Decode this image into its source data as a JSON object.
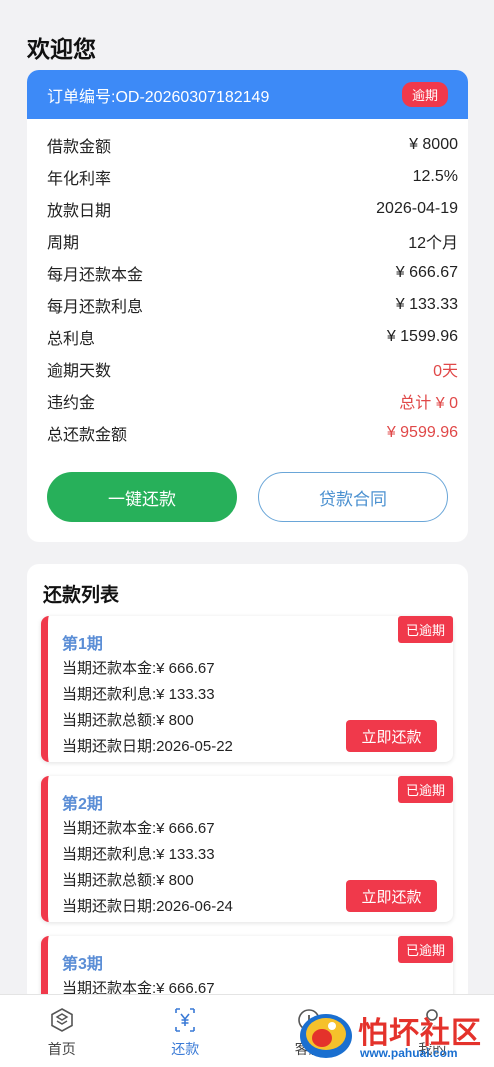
{
  "greeting": "欢迎您",
  "order": {
    "number_label": "订单编号:OD-20260307182149",
    "status_tag": "逾期",
    "rows": [
      {
        "label": "借款金额",
        "value": "¥ 8000"
      },
      {
        "label": "年化利率",
        "value": "12.5%"
      },
      {
        "label": "放款日期",
        "value": "2026-04-19"
      },
      {
        "label": "周期",
        "value": "12个月"
      },
      {
        "label": "每月还款本金",
        "value": "¥ 666.67"
      },
      {
        "label": "每月还款利息",
        "value": "¥ 133.33"
      },
      {
        "label": "总利息",
        "value": "¥ 1599.96"
      },
      {
        "label": "逾期天数",
        "value": "0天"
      },
      {
        "label": "违约金",
        "value": "总计 ¥ 0"
      },
      {
        "label": "总还款金额",
        "value": "¥ 9599.96"
      }
    ],
    "repay_button": "一键还款",
    "contract_button": "贷款合同"
  },
  "repay_list": {
    "title": "还款列表",
    "periods": [
      {
        "title": "第1期",
        "badge": "已逾期",
        "principal": "当期还款本金:¥ 666.67",
        "interest": "当期还款利息:¥ 133.33",
        "total": "当期还款总额:¥ 800",
        "date": "当期还款日期:2026-05-22",
        "button": "立即还款"
      },
      {
        "title": "第2期",
        "badge": "已逾期",
        "principal": "当期还款本金:¥ 666.67",
        "interest": "当期还款利息:¥ 133.33",
        "total": "当期还款总额:¥ 800",
        "date": "当期还款日期:2026-06-24",
        "button": "立即还款"
      },
      {
        "title": "第3期",
        "badge": "已逾期",
        "principal": "当期还款本金:¥ 666.67"
      }
    ]
  },
  "tabbar": {
    "home": "首页",
    "repay": "还款",
    "service": "客服",
    "mine": "我的"
  },
  "watermark": {
    "text": "怕坏社区",
    "url": "www.pahuai.com"
  },
  "colors": {
    "primary_blue": "#3d8af7",
    "danger_red": "#f0394b",
    "green": "#27b05a",
    "active_tab": "#3a7ad6"
  }
}
